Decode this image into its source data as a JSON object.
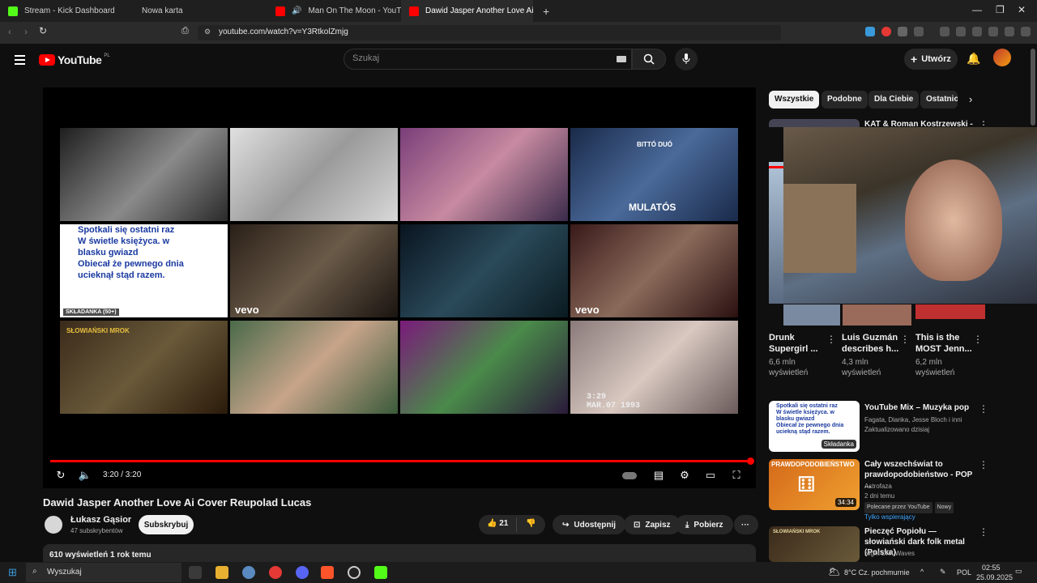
{
  "browser": {
    "tabs": [
      {
        "label": "Stream - Kick Dashboard",
        "color": "#53fc18"
      },
      {
        "label": "Nowa karta",
        "color": "#555555"
      },
      {
        "label": "Man On The Moon - YouTube",
        "color": "#ff0000"
      },
      {
        "label": "Dawid Jasper Another Love Ai C",
        "color": "#ff0000"
      }
    ],
    "url": "youtube.com/watch?v=Y3RtkolZmjg"
  },
  "header": {
    "logo_word": "YouTube",
    "logo_region": "PL",
    "search_placeholder": "Szukaj",
    "create_label": "Utwórz"
  },
  "player": {
    "time": "3:20 / 3:20",
    "progress": 1.0,
    "thumbs": [
      {
        "label": "",
        "bg": "linear-gradient(135deg,#1e1e1e,#8a8a8a 55%,#2a2a2a)"
      },
      {
        "label": "",
        "bg": "linear-gradient(135deg,#e0e0e0,#9a9a9a 50%,#d8d8d8)"
      },
      {
        "label": "",
        "bg": "linear-gradient(135deg,#7a3e7a,#c78aa0 50%,#3a2a4a)"
      },
      {
        "label": "BITTÓ DUÓ",
        "label2": "MULATÓS",
        "bg": "linear-gradient(135deg,#1a2a4a,#4a6a9a 50%,#1a2a4a)"
      },
      {
        "label": "Spotkali się ostatni raz\nW świetle księżyca. w\nblasku gwiazd\nObiecał że pewnego dnia\nucieknął stąd razem.",
        "caption": "SKŁADANKA (50+)",
        "bg": "#ffffff"
      },
      {
        "label": "vevo",
        "bg": "linear-gradient(135deg,#2a2018,#6a5a48 50%,#1a1410)"
      },
      {
        "label": "",
        "bg": "linear-gradient(135deg,#0a1420,#2a4a5a 50%,#0a1a20)"
      },
      {
        "label": "vevo",
        "bg": "linear-gradient(135deg,#3a1a1a,#8a6a5a 50%,#2a1010)"
      },
      {
        "label": "SŁOWIAŃSKI MROK",
        "bg": "linear-gradient(135deg,#3a2a1a,#6a5a3a 50%,#2a1a0a)"
      },
      {
        "label": "",
        "bg": "linear-gradient(135deg,#4a6a4a,#c7a48a 50%,#3a5a3a)"
      },
      {
        "label": "",
        "bg": "linear-gradient(135deg,#7a1a7a,#4a8a4a 50%,#2a1a3a)"
      },
      {
        "label": "3:29\nMAR.07 1993",
        "bg": "linear-gradient(135deg,#8a7a7a,#d8c8c0 50%,#6a5a5a)"
      }
    ]
  },
  "video": {
    "title": "Dawid Jasper Another Love Ai Cover Reupolad Lucas",
    "channel": "Łukasz Gąsior",
    "subscribers": "47 subskrybentów",
    "subscribe_label": "Subskrybuj",
    "likes": "21",
    "share_label": "Udostępnij",
    "save_label": "Zapisz",
    "download_label": "Pobierz",
    "description_stats": "610 wyświetleń  1 rok temu"
  },
  "sidebar": {
    "chips": [
      "Wszystkie",
      "Podobne",
      "Dla Ciebie",
      "Ostatnio"
    ],
    "first_item_title": "KAT & Roman Kostrzewski -",
    "shorts": [
      {
        "title": "Drunk Supergirl ...",
        "views": "6,6 mln wyświetleń"
      },
      {
        "title": "Luis Guzmán describes h...",
        "views": "4,3 mln wyświetleń"
      },
      {
        "title": "This is the MOST Jenn...",
        "views": "6,2 mln wyświetleń"
      }
    ],
    "recommendations": [
      {
        "title": "YouTube Mix – Muzyka pop",
        "meta1": "Fagata, Dianka, Jesse Bloch i inni",
        "meta2": "Zaktualizowano dzisiaj",
        "badge": "Składanka",
        "thumb_text": "Spotkali się ostatni raz\nW świetle księżyca. w\nblasku gwiazd\nObiecał że pewnego dnia\nuciekną stąd razem."
      },
      {
        "title": "Cały wszechświat to prawdopodobieństwo - POP ...",
        "meta1": "Astrofaza",
        "meta2": "2 dni temu",
        "tag1": "Polecane przez YouTube",
        "tag2": "Nowy",
        "members": "Tylko wspierający",
        "badge": "34:34",
        "thumb_text": "PRAWDOPODOBIEŃSTWO"
      },
      {
        "title": "Pieczęć Popiołu — słowiański dark folk metal (Polska)",
        "meta1": "Night Drift Waves",
        "thumb_text": "SŁOWIAŃSKI MROK"
      }
    ]
  },
  "taskbar": {
    "search_placeholder": "Wyszukaj",
    "weather": "8°C  Cz. pochmurnie",
    "lang": "POL",
    "time": "02:55",
    "date": "25.09.2025"
  }
}
